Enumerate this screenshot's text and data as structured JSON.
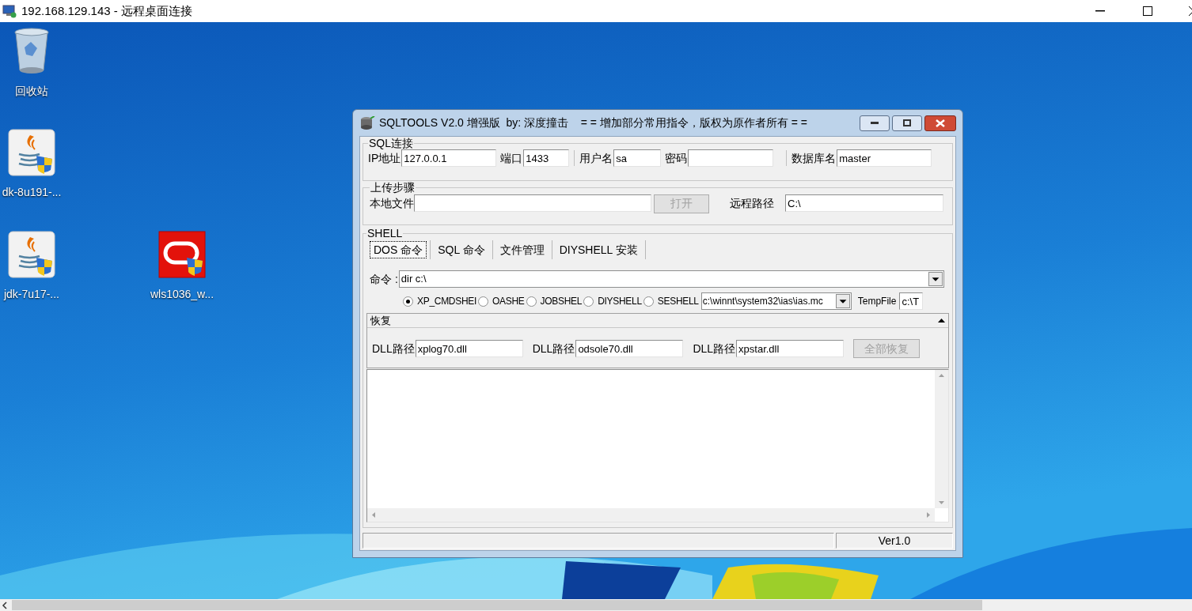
{
  "rdp_window": {
    "title": "192.168.129.143 - 远程桌面连接"
  },
  "desktop_icons": [
    {
      "kind": "recycle",
      "label": "回收站"
    },
    {
      "kind": "java",
      "label": "dk-8u191-..."
    },
    {
      "kind": "java",
      "label": "jdk-7u17-..."
    },
    {
      "kind": "oracle",
      "label": "wls1036_w..."
    }
  ],
  "app": {
    "title": "SQLTOOLS V2.0 增强版  by: 深度撞击    = = 增加部分常用指令，版权为原作者所有 = =",
    "sql_connection": {
      "title": "SQL连接",
      "fields": [
        {
          "label": "IP地址",
          "value": "127.0.0.1"
        },
        {
          "label": "端口",
          "value": "1433"
        },
        {
          "label": "用户名",
          "value": "sa"
        },
        {
          "label": "密码"
        },
        {
          "label": "数据库名",
          "value": "master"
        }
      ]
    },
    "upload": {
      "title": "上传步骤",
      "local_file_label": "本地文件",
      "open_button": {
        "label": "打开",
        "disabled": true
      },
      "remote_path_label": "远程路径",
      "remote_path": "C:\\"
    },
    "shell": {
      "title": "SHELL",
      "tabs": [
        {
          "label": "DOS 命令",
          "selected": true
        },
        {
          "label": "SQL 命令",
          "selected": false
        },
        {
          "label": "文件管理",
          "selected": false
        },
        {
          "label": "DIYSHELL 安装",
          "selected": false
        }
      ],
      "command_label": "命令 :",
      "command": "dir c:\\",
      "methods": [
        {
          "label": "XP_CMDSHEI",
          "selected": true
        },
        {
          "label": "OASHE",
          "selected": false
        },
        {
          "label": "JOBSHEL",
          "selected": false
        },
        {
          "label": "DIYSHELL",
          "selected": false
        },
        {
          "label": "SESHELL",
          "selected": false
        }
      ],
      "path_dropdown": "c:\\winnt\\system32\\ias\\ias.mc",
      "tempfile_label": "TempFile",
      "tempfile": "c:\\T",
      "restore": {
        "title": "恢复",
        "dlls": [
          {
            "label": "DLL路径",
            "value": "xplog70.dll"
          },
          {
            "label": "DLL路径",
            "value": "odsole70.dll"
          },
          {
            "label": "DLL路径",
            "value": "xpstar.dll"
          }
        ],
        "restore_all_button": {
          "label": "全部恢复",
          "disabled": true
        }
      }
    },
    "status_bar": {
      "version": "Ver1.0"
    }
  }
}
